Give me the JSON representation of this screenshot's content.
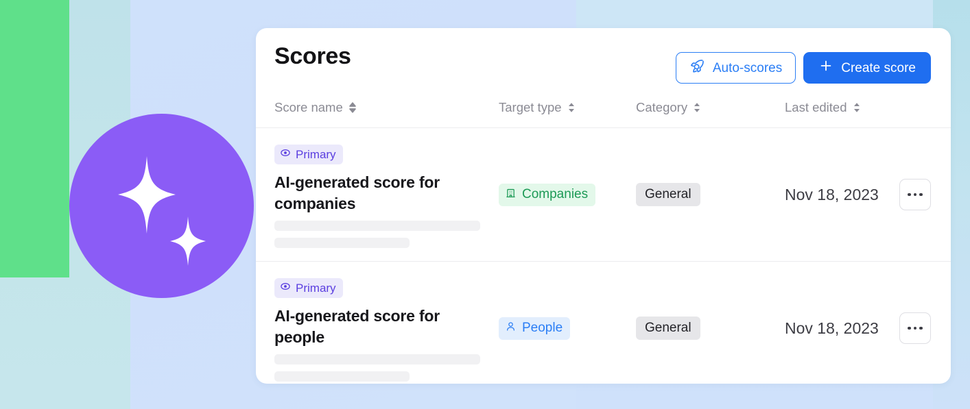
{
  "background": {
    "green_block_color": "#5fe08a",
    "circle_color": "#8b5cf6",
    "teal_color": "#bfe3ec",
    "blue_color": "#cfe1fb",
    "sparkle_icon": "sparkle-icon"
  },
  "card": {
    "title": "Scores",
    "actions": {
      "auto_scores": {
        "label": "Auto-scores",
        "icon": "rocket-icon",
        "color": "#2b7ef5"
      },
      "create_score": {
        "label": "Create score",
        "icon": "plus-icon",
        "color": "#1f6ef0"
      }
    },
    "columns": [
      {
        "label": "Score name",
        "sort_icon": "sort-updown-icon"
      },
      {
        "label": "Target type",
        "sort_icon": "sort-updown-icon"
      },
      {
        "label": "Category",
        "sort_icon": "sort-updown-icon"
      },
      {
        "label": "Last edited",
        "sort_icon": "sort-updown-icon"
      }
    ],
    "rows": [
      {
        "badge": {
          "label": "Primary",
          "icon": "eye-icon",
          "color": "#5b3fe0"
        },
        "name": "AI-generated score for companies",
        "target_type": {
          "label": "Companies",
          "icon": "building-icon",
          "color": "#1d9a56"
        },
        "category": "General",
        "last_edited": "Nov 18, 2023",
        "menu_icon": "ellipsis-icon"
      },
      {
        "badge": {
          "label": "Primary",
          "icon": "eye-icon",
          "color": "#5b3fe0"
        },
        "name": "AI-generated score for people",
        "target_type": {
          "label": "People",
          "icon": "person-icon",
          "color": "#2b7ef5"
        },
        "category": "General",
        "last_edited": "Nov 18, 2023",
        "menu_icon": "ellipsis-icon"
      }
    ]
  }
}
